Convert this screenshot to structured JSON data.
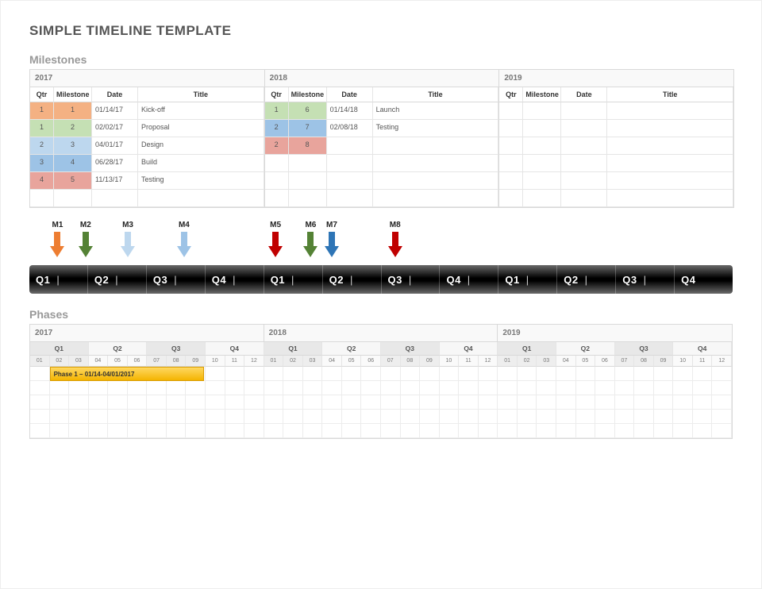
{
  "title": "SIMPLE TIMELINE TEMPLATE",
  "sections": {
    "milestones": "Milestones",
    "phases": "Phases"
  },
  "milestone_cols": {
    "qtr": "Qtr",
    "milestone": "Milestone",
    "date": "Date",
    "title": "Title"
  },
  "colors": {
    "orange": "#f4b183",
    "lgreen": "#c5e0b4",
    "lblue": "#bdd7ee",
    "mblue": "#9dc3e6",
    "salmon": "#e8a49c",
    "dgreen": "#a8d08d",
    "green": "#548235",
    "blue": "#2e75b6",
    "red": "#c00000",
    "dorange": "#ed7d31"
  },
  "milestones": {
    "years": [
      "2017",
      "2018",
      "2019"
    ],
    "rows": {
      "2017": [
        {
          "qtr": "1",
          "m": "1",
          "date": "01/14/17",
          "title": "Kick-off",
          "qc": "orange",
          "mc": "orange"
        },
        {
          "qtr": "1",
          "m": "2",
          "date": "02/02/17",
          "title": "Proposal",
          "qc": "lgreen",
          "mc": "lgreen"
        },
        {
          "qtr": "2",
          "m": "3",
          "date": "04/01/17",
          "title": "Design",
          "qc": "lblue",
          "mc": "lblue"
        },
        {
          "qtr": "3",
          "m": "4",
          "date": "06/28/17",
          "title": "Build",
          "qc": "mblue",
          "mc": "mblue"
        },
        {
          "qtr": "4",
          "m": "5",
          "date": "11/13/17",
          "title": "Testing",
          "qc": "salmon",
          "mc": "salmon"
        }
      ],
      "2018": [
        {
          "qtr": "1",
          "m": "6",
          "date": "01/14/18",
          "title": "Launch",
          "qc": "lgreen",
          "mc": "lgreen"
        },
        {
          "qtr": "2",
          "m": "7",
          "date": "02/08/18",
          "title": "Testing",
          "qc": "mblue",
          "mc": "mblue"
        },
        {
          "qtr": "2",
          "m": "8",
          "date": "",
          "title": "",
          "qc": "salmon",
          "mc": "salmon"
        }
      ],
      "2019": []
    },
    "blank_rows": {
      "2017": 1,
      "2018": 3,
      "2019": 6
    }
  },
  "arrows": [
    {
      "label": "M1",
      "pos": 4,
      "color": "dorange"
    },
    {
      "label": "M2",
      "pos": 8,
      "color": "green"
    },
    {
      "label": "M3",
      "pos": 14,
      "color": "lblue"
    },
    {
      "label": "M4",
      "pos": 22,
      "color": "mblue"
    },
    {
      "label": "M5",
      "pos": 35,
      "color": "red"
    },
    {
      "label": "M6",
      "pos": 40,
      "color": "green"
    },
    {
      "label": "M7",
      "pos": 43,
      "color": "blue"
    },
    {
      "label": "M8",
      "pos": 52,
      "color": "red"
    }
  ],
  "qbar": [
    "Q1",
    "Q2",
    "Q3",
    "Q4",
    "Q1",
    "Q2",
    "Q3",
    "Q4",
    "Q1",
    "Q2",
    "Q3",
    "Q4"
  ],
  "phases": {
    "years": [
      "2017",
      "2018",
      "2019"
    ],
    "quarters": [
      "Q1",
      "Q2",
      "Q3",
      "Q4"
    ],
    "months": [
      "01",
      "02",
      "03",
      "04",
      "05",
      "06",
      "07",
      "08",
      "09",
      "10",
      "11",
      "12"
    ],
    "phase1": {
      "label": "Phase 1 – 01/14-04/01/2017"
    },
    "body_rows": 5
  }
}
